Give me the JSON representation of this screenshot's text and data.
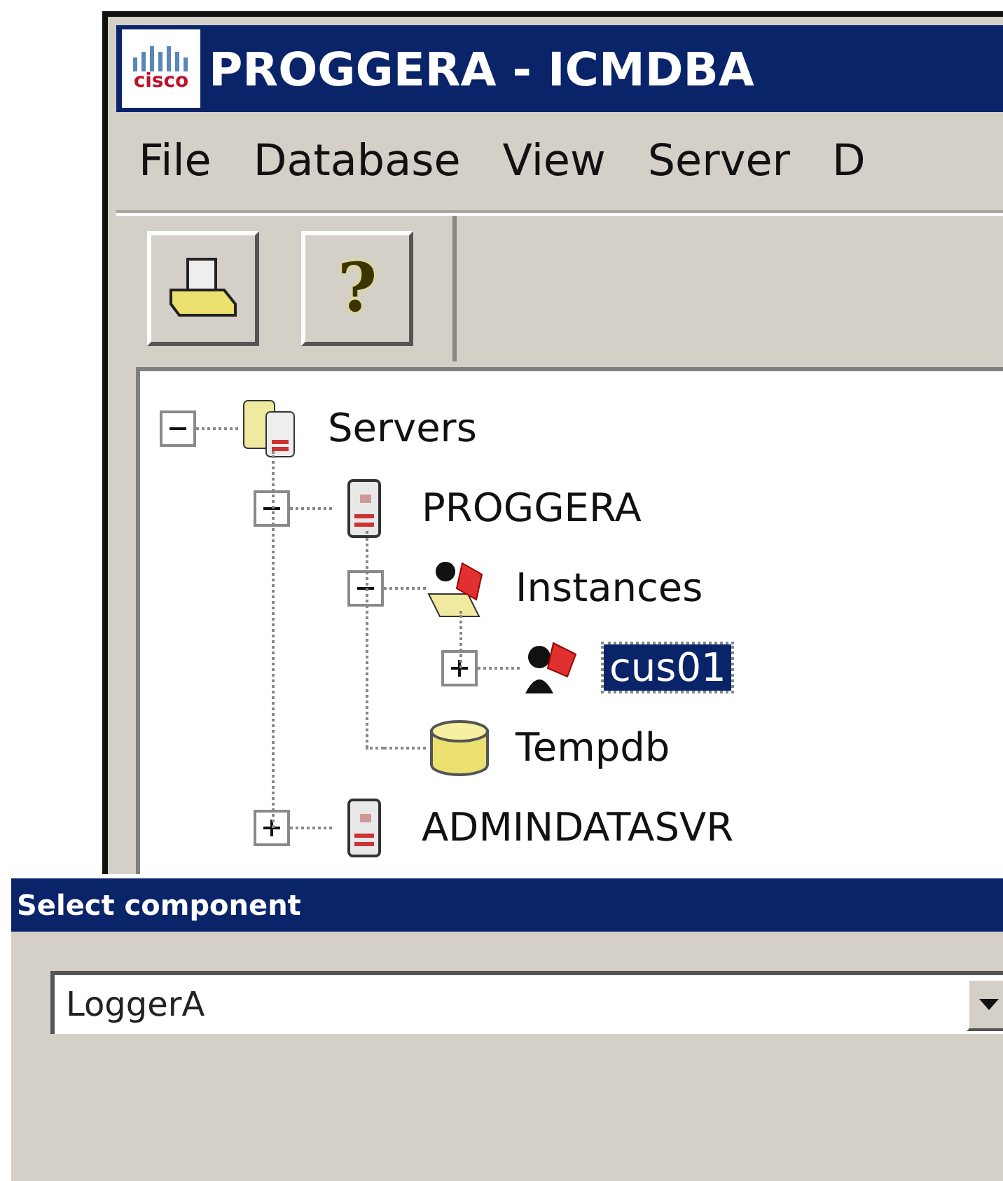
{
  "window": {
    "title": "PROGGERA - ICMDBA",
    "logo_text": "cisco"
  },
  "menu": [
    "File",
    "Database",
    "View",
    "Server",
    "D"
  ],
  "toolbar": [
    {
      "kind": "print"
    },
    {
      "kind": "help",
      "glyph": "?"
    }
  ],
  "tree": [
    {
      "label": "Servers",
      "kind": "servers",
      "expanded": true,
      "selected": false,
      "children": [
        {
          "label": "PROGGERA",
          "kind": "server",
          "expanded": true,
          "selected": false,
          "children": [
            {
              "label": "Instances",
              "kind": "instances",
              "expanded": true,
              "selected": false,
              "children": [
                {
                  "label": "cus01",
                  "kind": "instance",
                  "expanded": false,
                  "selected": true
                }
              ]
            },
            {
              "label": "Tempdb",
              "kind": "database",
              "selected": false
            }
          ]
        },
        {
          "label": "ADMINDATASVR",
          "kind": "server",
          "expanded": false,
          "selected": false
        }
      ]
    }
  ],
  "dialog": {
    "title": "Select component",
    "combo": {
      "value": "LoggerA"
    }
  }
}
